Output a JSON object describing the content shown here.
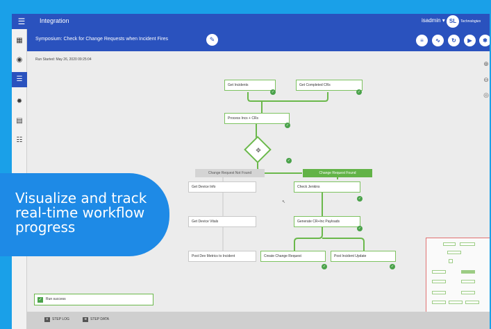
{
  "topbar": {
    "app_title": "Integration",
    "user": "isadmin ▾",
    "logo_mark": "SL",
    "logo_sub": "Technologies"
  },
  "sidebar": {
    "items": [
      {
        "icon": "dashboard-icon",
        "glyph": "▦"
      },
      {
        "icon": "camera-icon",
        "glyph": "◉"
      },
      {
        "icon": "list-icon",
        "glyph": "☰"
      },
      {
        "icon": "gear-icon",
        "glyph": "✹"
      },
      {
        "icon": "document-icon",
        "glyph": "▤"
      },
      {
        "icon": "users-icon",
        "glyph": "☷"
      }
    ],
    "menu_glyph": "☰"
  },
  "subheader": {
    "workflow_title": "Symposium: Check for Change Requests when Incident Fires",
    "edit_glyph": "✎",
    "tools": [
      {
        "icon": "log-icon",
        "glyph": "≡"
      },
      {
        "icon": "activity-icon",
        "glyph": "∿"
      },
      {
        "icon": "refresh-icon",
        "glyph": "↻"
      },
      {
        "icon": "play-icon",
        "glyph": "▶"
      },
      {
        "icon": "settings-icon",
        "glyph": "✱"
      }
    ]
  },
  "canvas": {
    "run_started": "Run Started: May 26, 2020 09:25:04",
    "zoom_in_glyph": "⊕",
    "zoom_out_glyph": "⊖",
    "fit_glyph": "◎"
  },
  "nodes": {
    "get_incidents": "Get Incidents",
    "get_completed_crs": "Get Completed CRs",
    "process_incs_crs": "Process Incs + CRs",
    "decision_glyph": "✥",
    "branch_not_found": "Change Request Not Found",
    "branch_found": "Change Request Found",
    "get_device_info": "Get Device Info",
    "check_jenkins": "Check Jenkins",
    "get_device_vitals": "Get Device Vitals",
    "generate_payloads": "Generate CR+Inc Payloads",
    "post_dev_metrics": "Post Dev Metrics to Incident",
    "create_change_request": "Create Change Request",
    "post_incident_update": "Post Incident Update",
    "check_glyph": "✓"
  },
  "status": {
    "text": "Run success",
    "glyph": "✓"
  },
  "bottombar": {
    "step_log": "STEP LOG",
    "step_data": "STEP DATA"
  },
  "callout": {
    "text": "Visualize and track real-time workflow progress"
  },
  "colors": {
    "brand_blue": "#2a52be",
    "success_green": "#4aa24a",
    "callout_blue": "#1e8ae6",
    "page_background": "#1aa0e8"
  }
}
